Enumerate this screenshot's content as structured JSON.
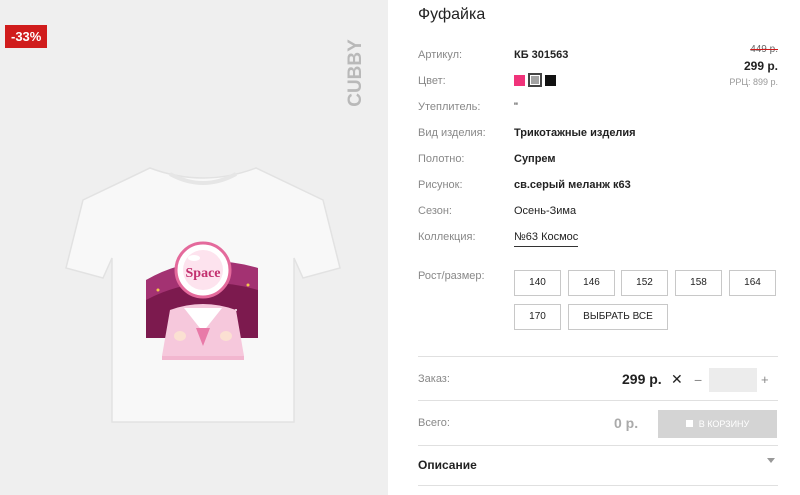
{
  "gallery": {
    "discount_badge": "-33%",
    "brand_logo": "CUBBY",
    "print_text": "Space"
  },
  "product": {
    "title": "Фуфайка",
    "attributes": [
      {
        "label": "Артикул:",
        "value": "КБ 301563"
      },
      {
        "label": "Цвет:",
        "value": ""
      },
      {
        "label": "Утеплитель:",
        "value": "\""
      },
      {
        "label": "Вид изделия:",
        "value": "Трикотажные изделия"
      },
      {
        "label": "Полотно:",
        "value": "Супрем"
      },
      {
        "label": "Рисунок:",
        "value": "св.серый меланж к63"
      },
      {
        "label": "Сезон:",
        "value": "Осень-Зима"
      },
      {
        "label": "Коллекция:",
        "value": "№63 Космос"
      }
    ],
    "colors": [
      {
        "name": "pink",
        "hex": "#f0337a"
      },
      {
        "name": "grey",
        "hex": "#a3a3a3",
        "selected": true
      },
      {
        "name": "black",
        "hex": "#111111"
      }
    ]
  },
  "price": {
    "old": "449 р.",
    "current": "299 р.",
    "rrp": "РРЦ: 899 р."
  },
  "sizes": {
    "label": "Рост/размер:",
    "options": [
      "140",
      "146",
      "152",
      "158",
      "164",
      "170"
    ],
    "select_all": "ВЫБРАТЬ ВСЕ"
  },
  "order": {
    "label": "Заказ:",
    "price": "299 р.",
    "times": "✕",
    "minus": "−",
    "plus": "+",
    "quantity": ""
  },
  "total": {
    "label": "Всего:",
    "value": "0 р.",
    "cart_button": "В КОРЗИНУ"
  },
  "description": {
    "label": "Описание"
  }
}
